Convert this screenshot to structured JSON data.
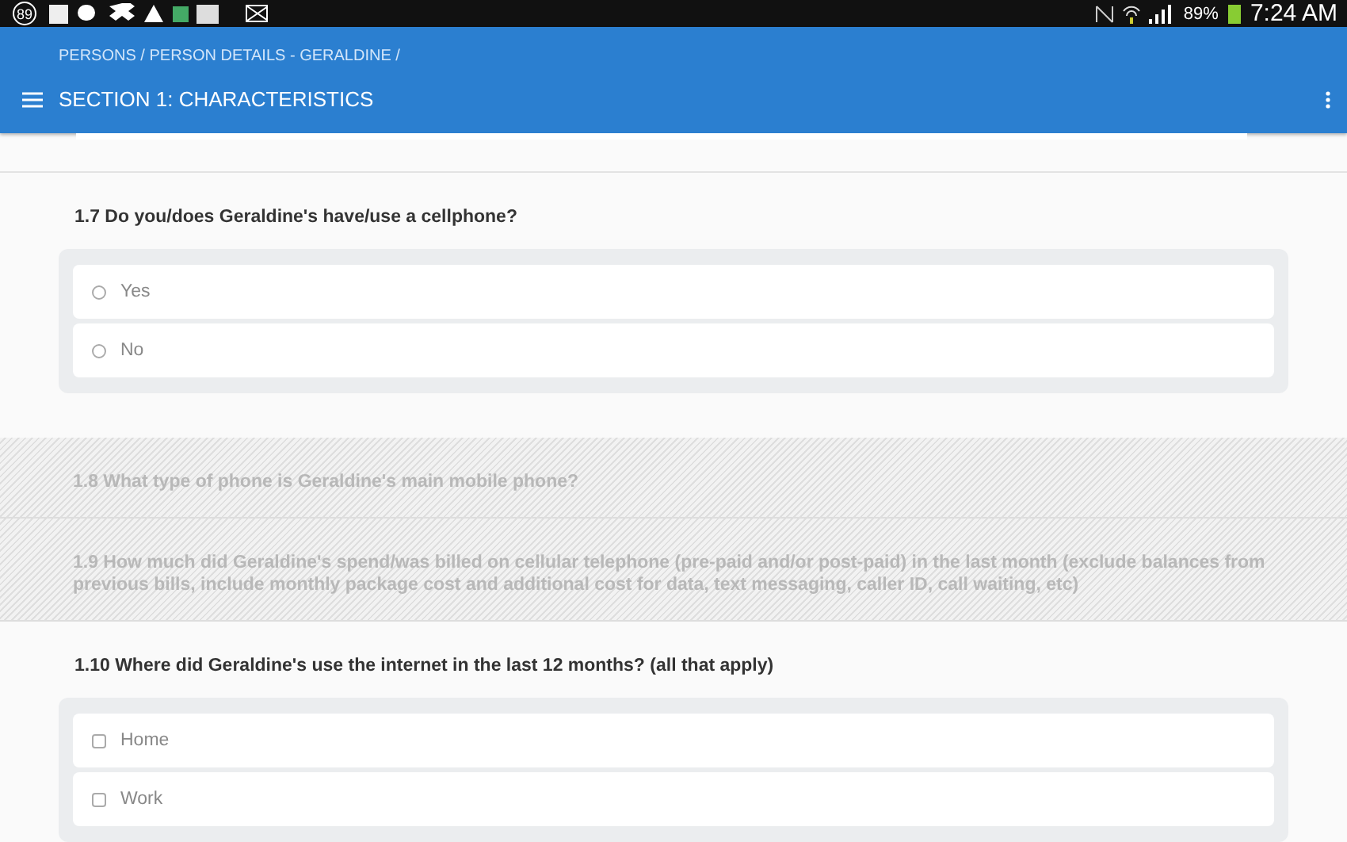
{
  "status_bar": {
    "notification_count": "89",
    "battery_percent": "89%",
    "time": "7:24 AM"
  },
  "app_bar": {
    "breadcrumb": "PERSONS / PERSON DETAILS - GERALDINE /",
    "title": "SECTION 1: CHARACTERISTICS"
  },
  "questions": [
    {
      "kind": "radio",
      "disabled": false,
      "text": "1.7 Do you/does Geraldine's have/use a cellphone?",
      "options": [
        {
          "label": "Yes",
          "checked": false
        },
        {
          "label": "No",
          "checked": false
        }
      ]
    },
    {
      "kind": "plain",
      "disabled": true,
      "text": "1.8 What type of phone is Geraldine's main mobile phone?"
    },
    {
      "kind": "plain",
      "disabled": true,
      "text": "1.9 How much did Geraldine's spend/was billed on cellular telephone (pre-paid and/or post-paid) in the last month (exclude balances from previous bills, include monthly package cost and additional cost for data, text messaging, caller ID, call waiting, etc)"
    },
    {
      "kind": "checkbox",
      "disabled": false,
      "text": "1.10 Where did Geraldine's use the internet in the last 12 months? (all that apply)",
      "options": [
        {
          "label": "Home",
          "checked": false
        },
        {
          "label": "Work",
          "checked": false
        }
      ]
    }
  ]
}
